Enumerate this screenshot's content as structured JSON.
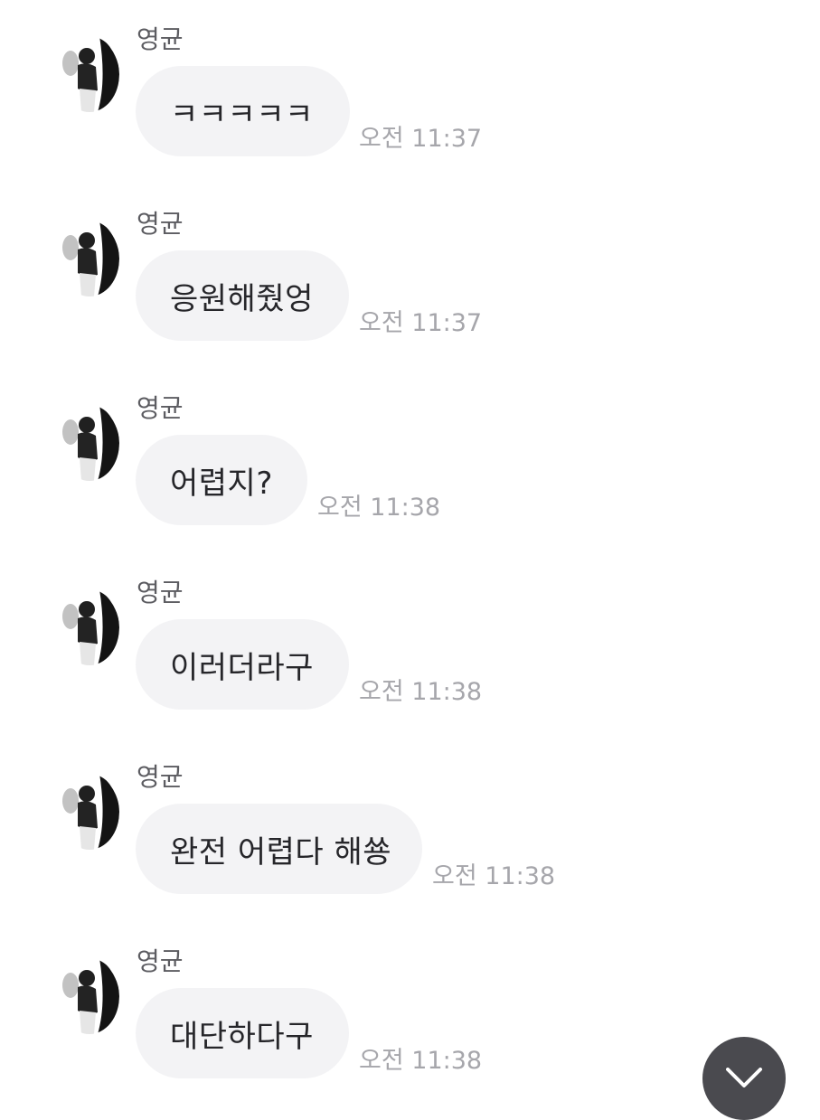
{
  "messages": [
    {
      "sender": "영균",
      "text": "ㅋㅋㅋㅋㅋ",
      "time": "오전 11:37"
    },
    {
      "sender": "영균",
      "text": "응원해줬엉",
      "time": "오전 11:37"
    },
    {
      "sender": "영균",
      "text": "어렵지?",
      "time": "오전 11:38"
    },
    {
      "sender": "영균",
      "text": "이러더라구",
      "time": "오전 11:38"
    },
    {
      "sender": "영균",
      "text": "완전 어렵다 해쑝",
      "time": "오전 11:38"
    },
    {
      "sender": "영균",
      "text": "대단하다구",
      "time": "오전 11:38"
    }
  ],
  "icons": {
    "avatar": "profile-photo",
    "scroll_button": "chevron-down-icon"
  },
  "colors": {
    "bubble": "#f3f3f5",
    "message_text": "#26262a",
    "sender_text": "#5c5c61",
    "time_text": "#a6a6ab",
    "scroll_button": "#4a4a4f"
  }
}
